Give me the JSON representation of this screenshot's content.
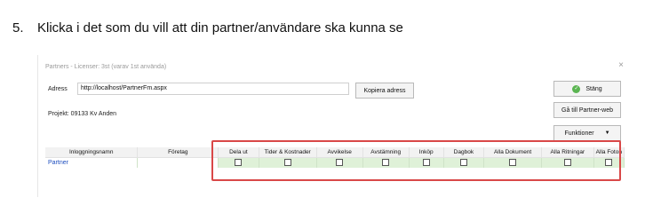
{
  "instruction": {
    "number": "5.",
    "text": "Klicka i det som du vill att din partner/användare ska kunna se"
  },
  "dialog": {
    "title": "Partners - Licenser: 3st (varav 1st använda)",
    "close_glyph": "×",
    "address_label": "Adress",
    "address_value": "http://localhost/PartnerFm.aspx",
    "copy_button": "Kopiera adress",
    "close_button": "Stäng",
    "partner_web_button": "Gå till Partner-web",
    "functions_button": "Funktioner",
    "project_label": "Projekt: 09133 Kv Anden"
  },
  "table": {
    "columns": [
      "Inloggningsnamn",
      "Företag",
      "Dela ut",
      "Tider & Kostnader",
      "Avvikelse",
      "Avstämning",
      "Inköp",
      "Dagbok",
      "Alla Dokument",
      "Alla Ritningar",
      "Alla Foton"
    ],
    "rows": [
      {
        "name": "Partner",
        "company": "",
        "checked": [
          false,
          false,
          false,
          false,
          false,
          false,
          false,
          false,
          false
        ]
      }
    ]
  }
}
